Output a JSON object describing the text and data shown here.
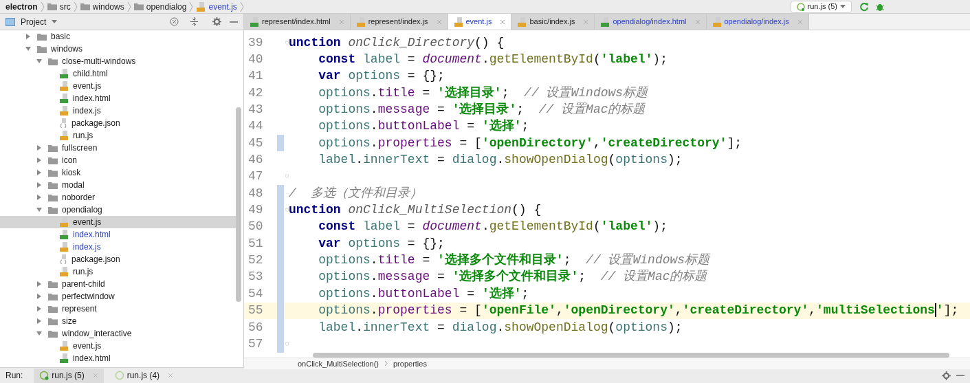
{
  "breadcrumb": [
    {
      "label": "electron",
      "kind": "project"
    },
    {
      "label": "src",
      "kind": "folder"
    },
    {
      "label": "windows",
      "kind": "folder"
    },
    {
      "label": "opendialog",
      "kind": "folder"
    },
    {
      "label": "event.js",
      "kind": "js"
    }
  ],
  "run_config": {
    "label": "run.js (5)"
  },
  "project_panel": {
    "title": "Project"
  },
  "tree": [
    {
      "label": "basic",
      "kind": "folder",
      "expanded": false,
      "selected": false,
      "modified": false
    },
    {
      "label": "windows",
      "kind": "folder",
      "expanded": true,
      "selected": false,
      "modified": false,
      "children": [
        {
          "label": "close-multi-windows",
          "kind": "folder",
          "expanded": true,
          "selected": false,
          "modified": false,
          "children": [
            {
              "label": "child.html",
              "kind": "html",
              "selected": false,
              "modified": false
            },
            {
              "label": "event.js",
              "kind": "js",
              "selected": false,
              "modified": false
            },
            {
              "label": "index.html",
              "kind": "html",
              "selected": false,
              "modified": false
            },
            {
              "label": "index.js",
              "kind": "js",
              "selected": false,
              "modified": false
            },
            {
              "label": "package.json",
              "kind": "json",
              "selected": false,
              "modified": false
            },
            {
              "label": "run.js",
              "kind": "js",
              "selected": false,
              "modified": false
            }
          ]
        },
        {
          "label": "fullscreen",
          "kind": "folder",
          "expanded": false,
          "selected": false,
          "modified": false
        },
        {
          "label": "icon",
          "kind": "folder",
          "expanded": false,
          "selected": false,
          "modified": false
        },
        {
          "label": "kiosk",
          "kind": "folder",
          "expanded": false,
          "selected": false,
          "modified": false
        },
        {
          "label": "modal",
          "kind": "folder",
          "expanded": false,
          "selected": false,
          "modified": false
        },
        {
          "label": "noborder",
          "kind": "folder",
          "expanded": false,
          "selected": false,
          "modified": false
        },
        {
          "label": "opendialog",
          "kind": "folder",
          "expanded": true,
          "selected": false,
          "modified": false,
          "children": [
            {
              "label": "event.js",
              "kind": "js",
              "selected": true,
              "modified": false
            },
            {
              "label": "index.html",
              "kind": "html",
              "selected": false,
              "modified": true
            },
            {
              "label": "index.js",
              "kind": "js",
              "selected": false,
              "modified": true
            },
            {
              "label": "package.json",
              "kind": "json",
              "selected": false,
              "modified": false
            },
            {
              "label": "run.js",
              "kind": "js",
              "selected": false,
              "modified": false
            }
          ]
        },
        {
          "label": "parent-child",
          "kind": "folder",
          "expanded": false,
          "selected": false,
          "modified": false
        },
        {
          "label": "perfectwindow",
          "kind": "folder",
          "expanded": false,
          "selected": false,
          "modified": false
        },
        {
          "label": "represent",
          "kind": "folder",
          "expanded": false,
          "selected": false,
          "modified": false
        },
        {
          "label": "size",
          "kind": "folder",
          "expanded": false,
          "selected": false,
          "modified": false
        },
        {
          "label": "window_interactive",
          "kind": "folder",
          "expanded": true,
          "selected": false,
          "modified": false,
          "children": [
            {
              "label": "event.js",
              "kind": "js",
              "selected": false,
              "modified": false
            },
            {
              "label": "index.html",
              "kind": "html",
              "selected": false,
              "modified": false
            }
          ]
        }
      ]
    }
  ],
  "tabs": [
    {
      "label": "represent/index.html",
      "kind": "html",
      "selected": false,
      "modified": false
    },
    {
      "label": "represent/index.js",
      "kind": "js",
      "selected": false,
      "modified": false
    },
    {
      "label": "event.js",
      "kind": "js",
      "selected": true,
      "modified": true
    },
    {
      "label": "basic/index.js",
      "kind": "js",
      "selected": false,
      "modified": false
    },
    {
      "label": "opendialog/index.html",
      "kind": "html",
      "selected": false,
      "modified": true
    },
    {
      "label": "opendialog/index.js",
      "kind": "js",
      "selected": false,
      "modified": true
    }
  ],
  "code_lines": [
    {
      "number": "39",
      "fold": true,
      "changed": false,
      "current": false,
      "tokens": [
        {
          "kind": "kw",
          "text": "unction "
        },
        {
          "kind": "fn",
          "text": "onClick_Directory"
        },
        {
          "kind": "plain",
          "text": "() {"
        }
      ]
    },
    {
      "number": "40",
      "fold": false,
      "changed": false,
      "current": false,
      "tokens": [
        {
          "kind": "kw",
          "text": "    const "
        },
        {
          "kind": "var",
          "text": "label"
        },
        {
          "kind": "plain",
          "text": " = "
        },
        {
          "kind": "obj",
          "text": "document"
        },
        {
          "kind": "plain",
          "text": "."
        },
        {
          "kind": "method",
          "text": "getElementById"
        },
        {
          "kind": "plain",
          "text": "("
        },
        {
          "kind": "str",
          "text": "'label'"
        },
        {
          "kind": "plain",
          "text": ");"
        }
      ]
    },
    {
      "number": "41",
      "fold": false,
      "changed": false,
      "current": false,
      "tokens": [
        {
          "kind": "kw",
          "text": "    var "
        },
        {
          "kind": "var",
          "text": "options"
        },
        {
          "kind": "plain",
          "text": " = {};"
        }
      ]
    },
    {
      "number": "42",
      "fold": false,
      "changed": false,
      "current": false,
      "tokens": [
        {
          "kind": "var",
          "text": "    options"
        },
        {
          "kind": "plain",
          "text": "."
        },
        {
          "kind": "prop",
          "text": "title"
        },
        {
          "kind": "plain",
          "text": " = "
        },
        {
          "kind": "str",
          "text": "'选择目录'"
        },
        {
          "kind": "plain",
          "text": ";  "
        },
        {
          "kind": "comment",
          "text": "// 设置Windows标题"
        }
      ]
    },
    {
      "number": "43",
      "fold": false,
      "changed": false,
      "current": false,
      "tokens": [
        {
          "kind": "var",
          "text": "    options"
        },
        {
          "kind": "plain",
          "text": "."
        },
        {
          "kind": "prop",
          "text": "message"
        },
        {
          "kind": "plain",
          "text": " = "
        },
        {
          "kind": "str",
          "text": "'选择目录'"
        },
        {
          "kind": "plain",
          "text": ";  "
        },
        {
          "kind": "comment",
          "text": "// 设置Mac的标题"
        }
      ]
    },
    {
      "number": "44",
      "fold": false,
      "changed": false,
      "current": false,
      "tokens": [
        {
          "kind": "var",
          "text": "    options"
        },
        {
          "kind": "plain",
          "text": "."
        },
        {
          "kind": "prop",
          "text": "buttonLabel"
        },
        {
          "kind": "plain",
          "text": " = "
        },
        {
          "kind": "str",
          "text": "'选择'"
        },
        {
          "kind": "plain",
          "text": ";"
        }
      ]
    },
    {
      "number": "45",
      "fold": false,
      "changed": true,
      "current": false,
      "tokens": [
        {
          "kind": "var",
          "text": "    options"
        },
        {
          "kind": "plain",
          "text": "."
        },
        {
          "kind": "prop",
          "text": "properties"
        },
        {
          "kind": "plain",
          "text": " = ["
        },
        {
          "kind": "str",
          "text": "'openDirectory'"
        },
        {
          "kind": "plain",
          "text": ","
        },
        {
          "kind": "str",
          "text": "'createDirectory'"
        },
        {
          "kind": "plain",
          "text": "];"
        }
      ]
    },
    {
      "number": "46",
      "fold": false,
      "changed": false,
      "current": false,
      "tokens": [
        {
          "kind": "var",
          "text": "    label"
        },
        {
          "kind": "plain",
          "text": "."
        },
        {
          "kind": "var",
          "text": "innerText"
        },
        {
          "kind": "plain",
          "text": " = "
        },
        {
          "kind": "var",
          "text": "dialog"
        },
        {
          "kind": "plain",
          "text": "."
        },
        {
          "kind": "method",
          "text": "showOpenDialog"
        },
        {
          "kind": "plain",
          "text": "("
        },
        {
          "kind": "var",
          "text": "options"
        },
        {
          "kind": "plain",
          "text": ");"
        }
      ]
    },
    {
      "number": "47",
      "fold": true,
      "changed": false,
      "current": false
    },
    {
      "number": "48",
      "fold": false,
      "changed": true,
      "current": false,
      "tokens": [
        {
          "kind": "comment",
          "text": "/  多选（文件和目录）"
        }
      ]
    },
    {
      "number": "49",
      "fold": true,
      "changed": true,
      "current": false,
      "tokens": [
        {
          "kind": "kw",
          "text": "unction "
        },
        {
          "kind": "fn",
          "text": "onClick_MultiSelection"
        },
        {
          "kind": "plain",
          "text": "() {"
        }
      ]
    },
    {
      "number": "50",
      "fold": false,
      "changed": true,
      "current": false,
      "tokens": [
        {
          "kind": "kw",
          "text": "    const "
        },
        {
          "kind": "var",
          "text": "label"
        },
        {
          "kind": "plain",
          "text": " = "
        },
        {
          "kind": "obj",
          "text": "document"
        },
        {
          "kind": "plain",
          "text": "."
        },
        {
          "kind": "method",
          "text": "getElementById"
        },
        {
          "kind": "plain",
          "text": "("
        },
        {
          "kind": "str",
          "text": "'label'"
        },
        {
          "kind": "plain",
          "text": ");"
        }
      ]
    },
    {
      "number": "51",
      "fold": false,
      "changed": true,
      "current": false,
      "tokens": [
        {
          "kind": "kw",
          "text": "    var "
        },
        {
          "kind": "var",
          "text": "options"
        },
        {
          "kind": "plain",
          "text": " = {};"
        }
      ]
    },
    {
      "number": "52",
      "fold": false,
      "changed": true,
      "current": false,
      "tokens": [
        {
          "kind": "var",
          "text": "    options"
        },
        {
          "kind": "plain",
          "text": "."
        },
        {
          "kind": "prop",
          "text": "title"
        },
        {
          "kind": "plain",
          "text": " = "
        },
        {
          "kind": "str",
          "text": "'选择多个文件和目录'"
        },
        {
          "kind": "plain",
          "text": ";  "
        },
        {
          "kind": "comment",
          "text": "// 设置Windows标题"
        }
      ]
    },
    {
      "number": "53",
      "fold": false,
      "changed": true,
      "current": false,
      "tokens": [
        {
          "kind": "var",
          "text": "    options"
        },
        {
          "kind": "plain",
          "text": "."
        },
        {
          "kind": "prop",
          "text": "message"
        },
        {
          "kind": "plain",
          "text": " = "
        },
        {
          "kind": "str",
          "text": "'选择多个文件和目录'"
        },
        {
          "kind": "plain",
          "text": ";  "
        },
        {
          "kind": "comment",
          "text": "// 设置Mac的标题"
        }
      ]
    },
    {
      "number": "54",
      "fold": false,
      "changed": true,
      "current": false,
      "tokens": [
        {
          "kind": "var",
          "text": "    options"
        },
        {
          "kind": "plain",
          "text": "."
        },
        {
          "kind": "prop",
          "text": "buttonLabel"
        },
        {
          "kind": "plain",
          "text": " = "
        },
        {
          "kind": "str",
          "text": "'选择'"
        },
        {
          "kind": "plain",
          "text": ";"
        }
      ]
    },
    {
      "number": "55",
      "fold": false,
      "changed": true,
      "current": true,
      "tokens": [
        {
          "kind": "var",
          "text": "    options"
        },
        {
          "kind": "plain",
          "text": "."
        },
        {
          "kind": "prop",
          "text": "properties"
        },
        {
          "kind": "plain",
          "text": " = ["
        },
        {
          "kind": "str",
          "text": "'openFile'"
        },
        {
          "kind": "plain",
          "text": ","
        },
        {
          "kind": "str",
          "text": "'openDirectory'"
        },
        {
          "kind": "plain",
          "text": ","
        },
        {
          "kind": "str",
          "text": "'createDirectory'"
        },
        {
          "kind": "plain",
          "text": ","
        },
        {
          "kind": "str",
          "text": "'multiSelections",
          "caret": true
        },
        {
          "kind": "str",
          "text": "'"
        },
        {
          "kind": "plain",
          "text": "];"
        }
      ]
    },
    {
      "number": "56",
      "fold": false,
      "changed": true,
      "current": false,
      "tokens": [
        {
          "kind": "var",
          "text": "    label"
        },
        {
          "kind": "plain",
          "text": "."
        },
        {
          "kind": "var",
          "text": "innerText"
        },
        {
          "kind": "plain",
          "text": " = "
        },
        {
          "kind": "var",
          "text": "dialog"
        },
        {
          "kind": "plain",
          "text": "."
        },
        {
          "kind": "method",
          "text": "showOpenDialog"
        },
        {
          "kind": "plain",
          "text": "("
        },
        {
          "kind": "var",
          "text": "options"
        },
        {
          "kind": "plain",
          "text": ");"
        }
      ]
    },
    {
      "number": "57",
      "fold": true,
      "changed": true,
      "current": false
    }
  ],
  "editor_breadcrumb": [
    "onClick_MultiSelection()",
    "properties"
  ],
  "run_bar": {
    "label": "Run:",
    "tabs": [
      {
        "label": "run.js (5)",
        "selected": true
      },
      {
        "label": "run.js (4)",
        "selected": false
      }
    ]
  }
}
